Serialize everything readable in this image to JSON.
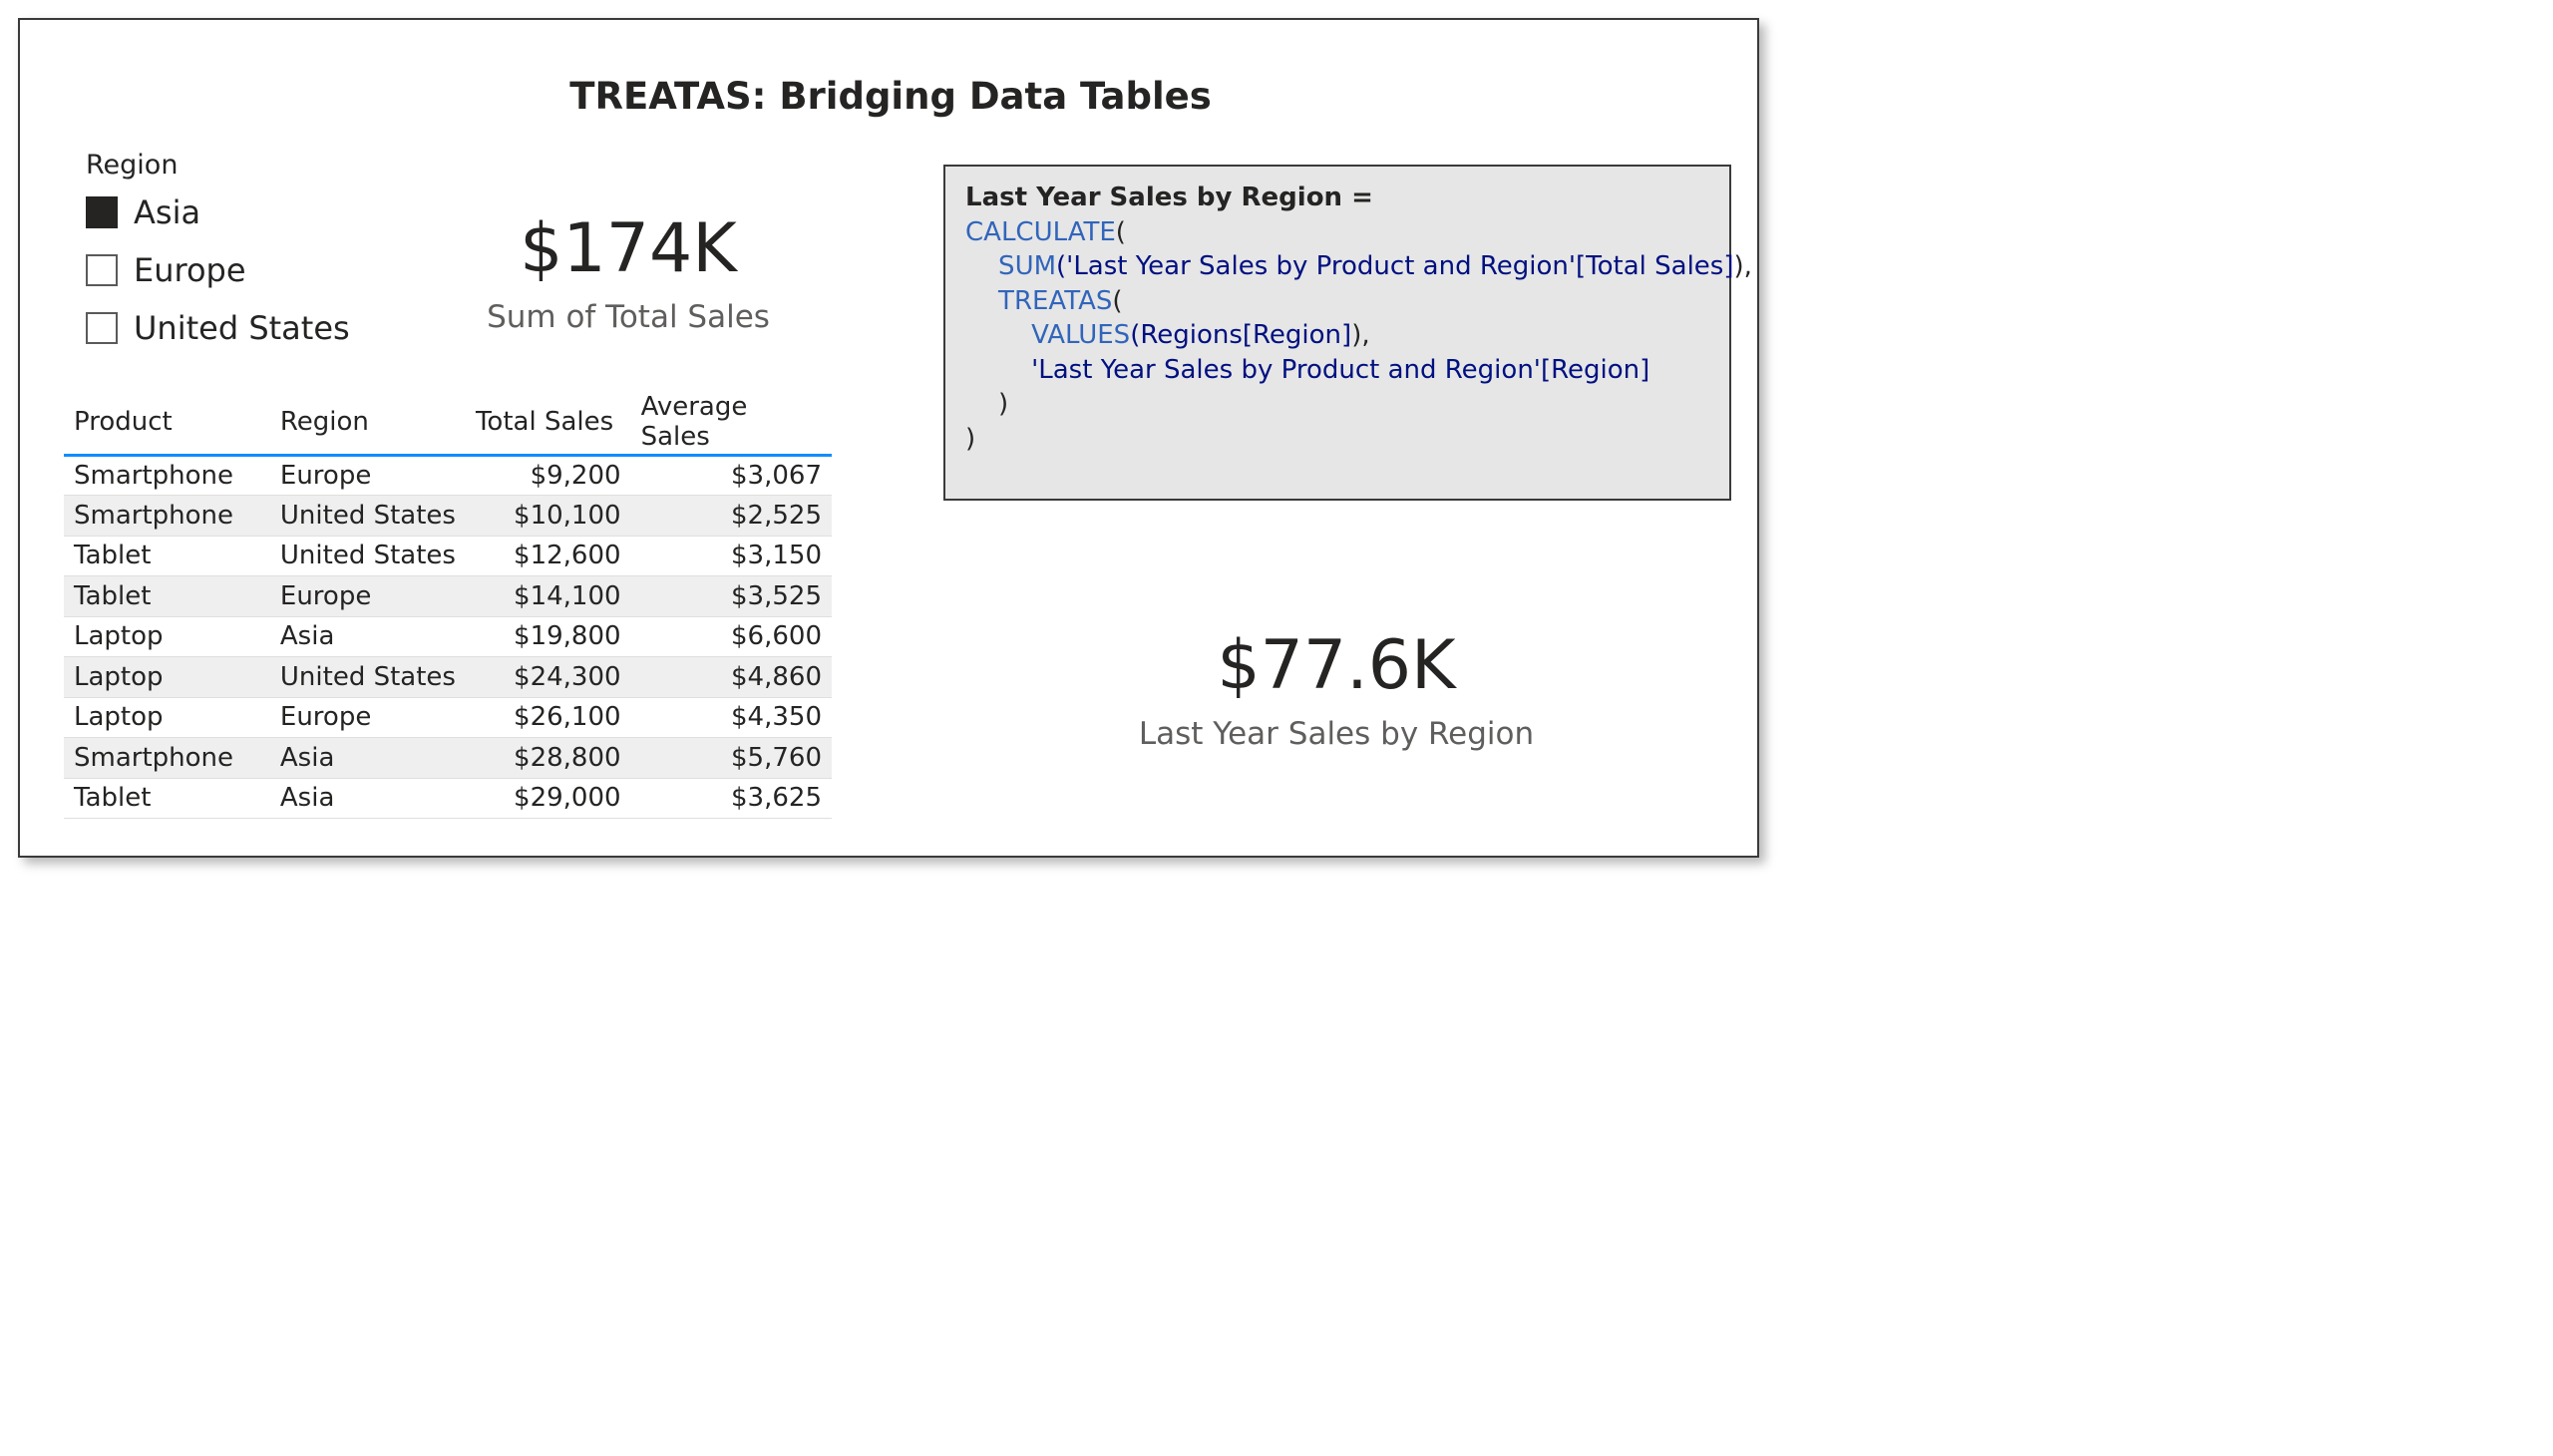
{
  "report": {
    "title": "TREATAS: Bridging Data Tables"
  },
  "slicer": {
    "header": "Region",
    "items": [
      {
        "label": "Asia",
        "checked": true
      },
      {
        "label": "Europe",
        "checked": false
      },
      {
        "label": "United States",
        "checked": false
      }
    ]
  },
  "card_total": {
    "value": "$174K",
    "label": "Sum of Total Sales"
  },
  "table": {
    "columns": [
      "Product",
      "Region",
      "Total Sales",
      "Average Sales"
    ],
    "rows": [
      [
        "Smartphone",
        "Europe",
        "$9,200",
        "$3,067"
      ],
      [
        "Smartphone",
        "United States",
        "$10,100",
        "$2,525"
      ],
      [
        "Tablet",
        "United States",
        "$12,600",
        "$3,150"
      ],
      [
        "Tablet",
        "Europe",
        "$14,100",
        "$3,525"
      ],
      [
        "Laptop",
        "Asia",
        "$19,800",
        "$6,600"
      ],
      [
        "Laptop",
        "United States",
        "$24,300",
        "$4,860"
      ],
      [
        "Laptop",
        "Europe",
        "$26,100",
        "$4,350"
      ],
      [
        "Smartphone",
        "Asia",
        "$28,800",
        "$5,760"
      ],
      [
        "Tablet",
        "Asia",
        "$29,000",
        "$3,625"
      ]
    ]
  },
  "code": {
    "title": "Last Year Sales by Region =",
    "lines": [
      [
        {
          "t": "CALCULATE",
          "c": "kw"
        },
        {
          "t": "(",
          "c": "pn"
        }
      ],
      [
        {
          "t": "    SUM",
          "c": "kw"
        },
        {
          "t": "('Last Year Sales by Product and Region'[Total Sales]",
          "c": "tx"
        },
        {
          "t": "),",
          "c": "pn"
        }
      ],
      [
        {
          "t": "    TREATAS",
          "c": "kw"
        },
        {
          "t": "(",
          "c": "pn"
        }
      ],
      [
        {
          "t": "        VALUES",
          "c": "kw"
        },
        {
          "t": "(Regions[Region]",
          "c": "tx"
        },
        {
          "t": "),",
          "c": "pn"
        }
      ],
      [
        {
          "t": "        'Last Year Sales by Product and Region'[Region]",
          "c": "tx"
        }
      ],
      [
        {
          "t": "    )",
          "c": "pn"
        }
      ],
      [
        {
          "t": ")",
          "c": "pn"
        }
      ]
    ]
  },
  "card_region": {
    "value": "$77.6K",
    "label": "Last Year Sales by Region"
  },
  "colors": {
    "accent": "#118dff",
    "keyword": "#3165bb",
    "identifier": "#001080",
    "code_background": "#e6e6e6"
  }
}
